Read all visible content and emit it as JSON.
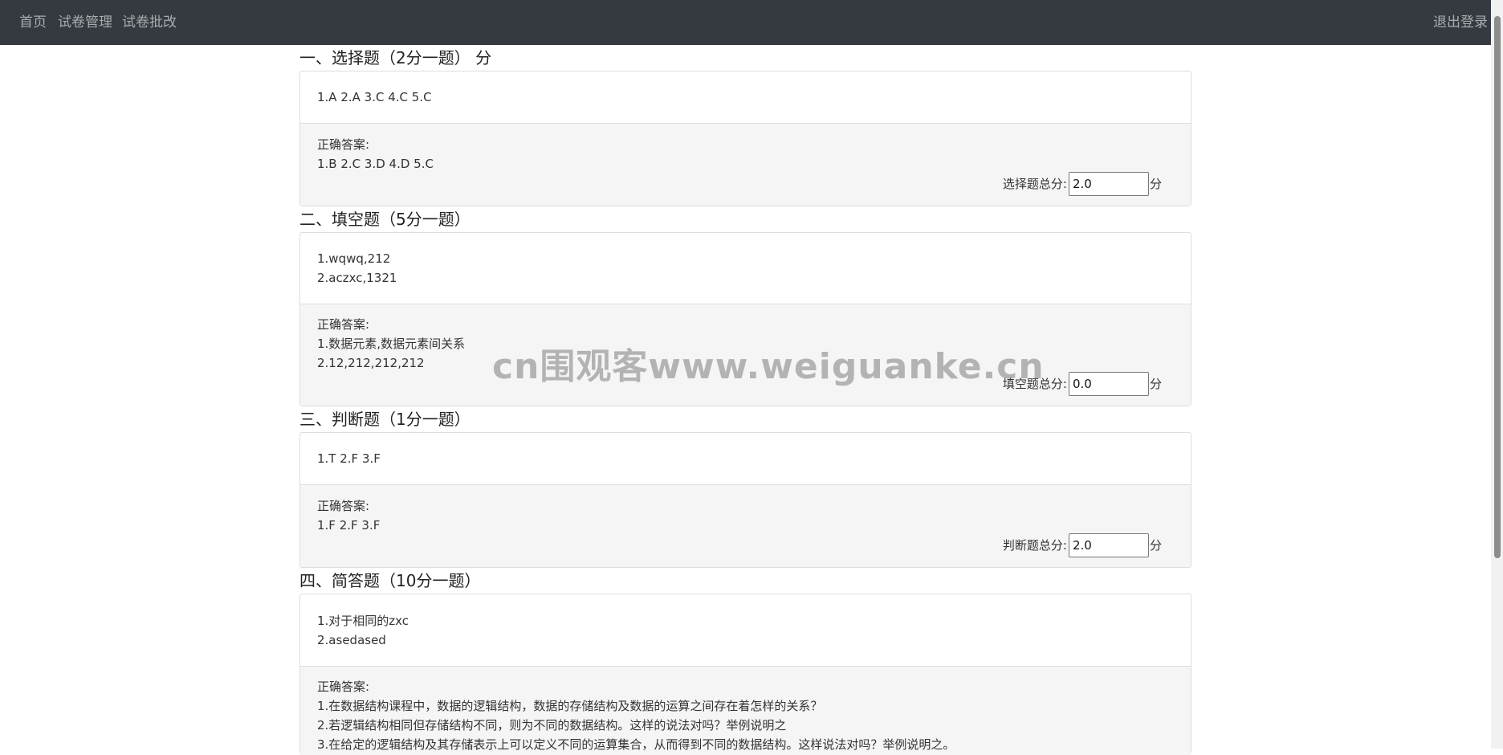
{
  "nav": {
    "home": "首页",
    "exam_manage": "试卷管理",
    "exam_grade": "试卷批改",
    "logout": "退出登录"
  },
  "sections": [
    {
      "title": "一、选择题（2分一题） 分",
      "answers": [
        "1.A 2.A 3.C 4.C 5.C"
      ],
      "correct_label": "正确答案:",
      "correct": [
        "1.B 2.C 3.D 4.D 5.C"
      ],
      "score_label": "选择题总分:",
      "score_value": "2.0",
      "unit": "分"
    },
    {
      "title": "二、填空题（5分一题）",
      "answers": [
        "1.wqwq,212",
        "2.aczxc,1321"
      ],
      "correct_label": "正确答案:",
      "correct": [
        "1.数据元素,数据元素间关系",
        "2.12,212,212,212"
      ],
      "score_label": "填空题总分:",
      "score_value": "0.0",
      "unit": "分"
    },
    {
      "title": "三、判断题（1分一题）",
      "answers": [
        "1.T 2.F 3.F"
      ],
      "correct_label": "正确答案:",
      "correct": [
        "1.F 2.F 3.F"
      ],
      "score_label": "判断题总分:",
      "score_value": "2.0",
      "unit": "分"
    },
    {
      "title": "四、简答题（10分一题）",
      "answers": [
        "1.对于相同的zxc",
        "2.asedased"
      ],
      "correct_label": "正确答案:",
      "correct": [
        "1.在数据结构课程中，数据的逻辑结构，数据的存储结构及数据的运算之间存在着怎样的关系？",
        "2.若逻辑结构相同但存储结构不同，则为不同的数据结构。这样的说法对吗？举例说明之",
        "3.在给定的逻辑结构及其存储表示上可以定义不同的运算集合，从而得到不同的数据结构。这样说法对吗？举例说明之。"
      ]
    }
  ],
  "watermark": "cn围观客www.weiguanke.cn"
}
